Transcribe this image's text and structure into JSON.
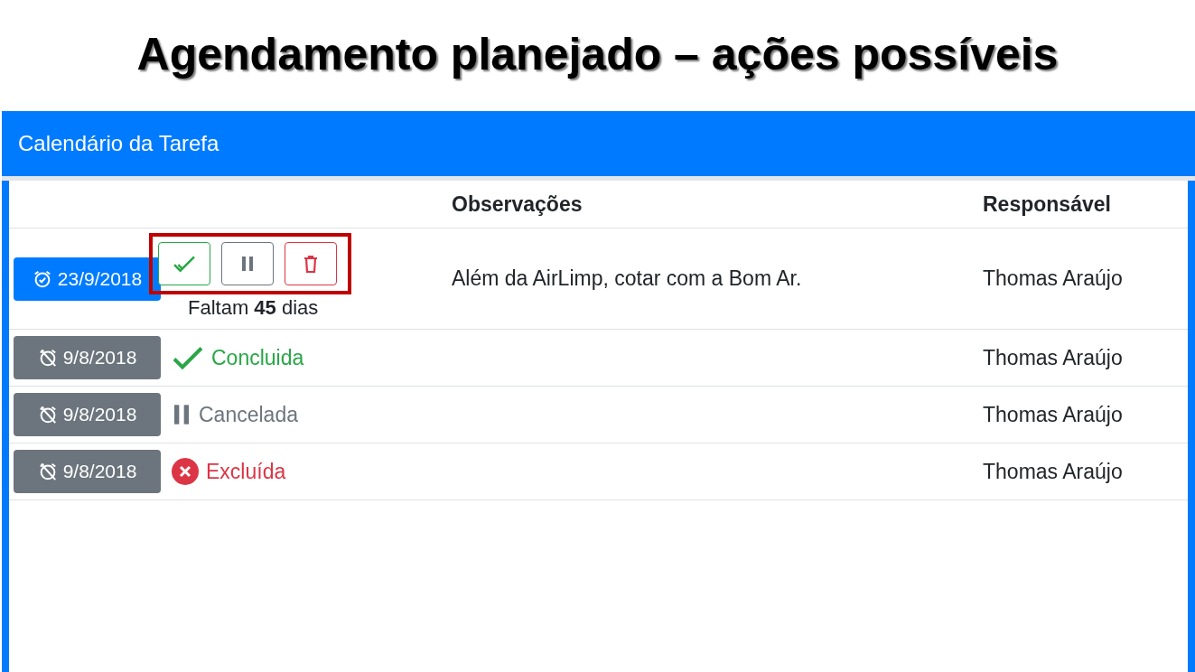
{
  "slide_title": "Agendamento planejado – ações possíveis",
  "panel": {
    "title": "Calendário da Tarefa"
  },
  "table": {
    "columns": [
      "Observações",
      "Responsável"
    ],
    "rows": [
      {
        "kind": "active",
        "date": "23/9/2018",
        "actions_highlighted": true,
        "actions": [
          {
            "kind": "done"
          },
          {
            "kind": "pause"
          },
          {
            "kind": "delete"
          }
        ],
        "countdown": "Faltam **45** dias",
        "observation": "Além da AirLimp, cotar com a Bom Ar.",
        "responsible": "Thomas Araújo"
      },
      {
        "kind": "closed",
        "date": "9/8/2018",
        "status": {
          "kind": "done",
          "label": "Concluida"
        },
        "responsible": "Thomas Araújo"
      },
      {
        "kind": "closed",
        "date": "9/8/2018",
        "status": {
          "kind": "pause",
          "label": "Cancelada"
        },
        "responsible": "Thomas Araújo"
      },
      {
        "kind": "closed",
        "date": "9/8/2018",
        "status": {
          "kind": "delete",
          "label": "Excluída"
        },
        "responsible": "Thomas Araújo"
      }
    ]
  }
}
